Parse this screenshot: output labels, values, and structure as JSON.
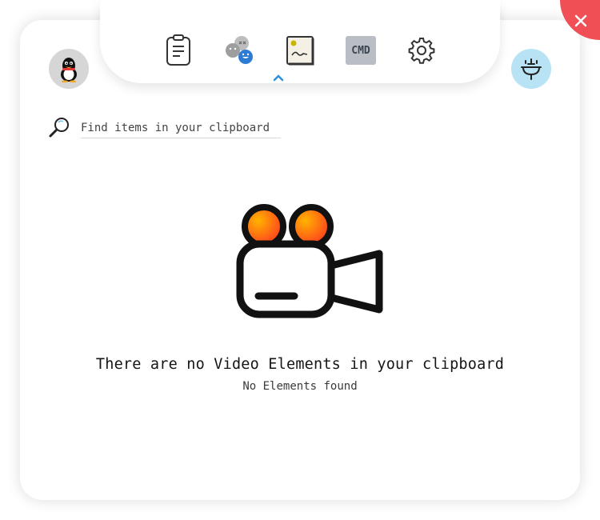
{
  "tabs": [
    {
      "name": "clipboard-text",
      "icon": "clipboard-icon",
      "active": true
    },
    {
      "name": "emoji",
      "icon": "emoji-faces-icon",
      "active": false
    },
    {
      "name": "images",
      "icon": "image-icon",
      "active": false
    },
    {
      "name": "commands",
      "icon": "cmd-icon",
      "label": "CMD",
      "active": false
    },
    {
      "name": "settings",
      "icon": "gear-icon",
      "active": false
    }
  ],
  "avatar": {
    "icon": "penguin-icon"
  },
  "clear_button": {
    "icon": "sink-icon"
  },
  "close_button": {
    "icon": "close-icon"
  },
  "search": {
    "placeholder": "Find items in your clipboard",
    "value": ""
  },
  "empty_state": {
    "icon": "video-camera-icon",
    "title": "There are no Video Elements in your clipboard",
    "subtitle": "No Elements found"
  },
  "colors": {
    "close": "#f04f55",
    "clear": "#b8e3f5",
    "active_caret": "#2f8fd8",
    "reel_gradient_start": "#ffb300",
    "reel_gradient_end": "#ff3d1f"
  }
}
